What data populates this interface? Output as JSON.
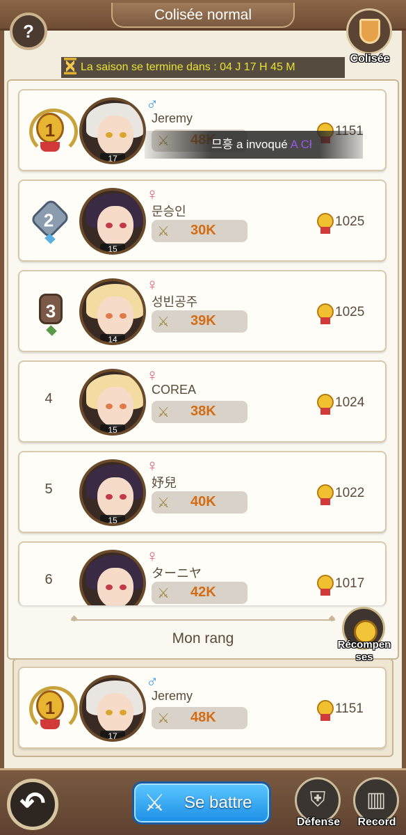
{
  "header": {
    "title": "Colisée normal",
    "help_label": "?",
    "colisee_label": "Colisée"
  },
  "season": {
    "text": "La saison se termine dans  : 04 J 17 H 45 M"
  },
  "chat": {
    "prefix": "므흥 a invoqué ",
    "highlight": "A Cł"
  },
  "ranking": [
    {
      "rank": "1",
      "medal": "gold",
      "name": "Jeremy",
      "gender": "male",
      "gender_symbol": "♂",
      "level": "17",
      "power": "48K",
      "score": "1151",
      "hair": "#e9e6e2",
      "eye": "#d8a62a"
    },
    {
      "rank": "2",
      "medal": "silver",
      "name": "문승인",
      "gender": "female",
      "gender_symbol": "♀",
      "level": "15",
      "power": "30K",
      "score": "1025",
      "hair": "#3a2a44",
      "eye": "#c23a4a"
    },
    {
      "rank": "3",
      "medal": "bronze",
      "name": "성빈공주",
      "gender": "female",
      "gender_symbol": "♀",
      "level": "14",
      "power": "39K",
      "score": "1025",
      "hair": "#f2dca2",
      "eye": "#e07a4a"
    },
    {
      "rank": "4",
      "medal": "",
      "name": "COREA",
      "gender": "female",
      "gender_symbol": "♀",
      "level": "15",
      "power": "38K",
      "score": "1024",
      "hair": "#f2dca2",
      "eye": "#e07a4a"
    },
    {
      "rank": "5",
      "medal": "",
      "name": "妤兒",
      "gender": "female",
      "gender_symbol": "♀",
      "level": "15",
      "power": "40K",
      "score": "1022",
      "hair": "#3a2a44",
      "eye": "#c23a4a"
    },
    {
      "rank": "6",
      "medal": "",
      "name": "ターニヤ",
      "gender": "female",
      "gender_symbol": "♀",
      "level": "",
      "power": "42K",
      "score": "1017",
      "hair": "#3a2a44",
      "eye": "#c23a4a"
    }
  ],
  "my_rank": {
    "title": "Mon rang",
    "rank": "1",
    "medal": "gold",
    "name": "Jeremy",
    "gender": "male",
    "gender_symbol": "♂",
    "level": "17",
    "power": "48K",
    "score": "1151",
    "hair": "#e9e6e2",
    "eye": "#d8a62a"
  },
  "rewards": {
    "label_line1": "Récompen",
    "label_line2": "ses"
  },
  "footer": {
    "back_icon": "↶",
    "fight_label": "Se battre",
    "defense_label": "Défense",
    "record_label": "Record"
  },
  "icons": {
    "help": "question-icon",
    "colisee": "shield-sword-icon",
    "hourglass": "hourglass-icon",
    "score": "medal-icon",
    "power": "crossed-swords-icon",
    "rewards": "trophy-medal-icon",
    "back": "back-arrow-icon",
    "fight": "crossed-swords-icon",
    "defense": "shield-icon",
    "record": "bar-chart-icon"
  },
  "colors": {
    "accent_blue": "#1c8fe6",
    "power_orange": "#d36c14",
    "season_text": "#e8e233",
    "male": "#3a9ae0",
    "female": "#e0607a"
  }
}
